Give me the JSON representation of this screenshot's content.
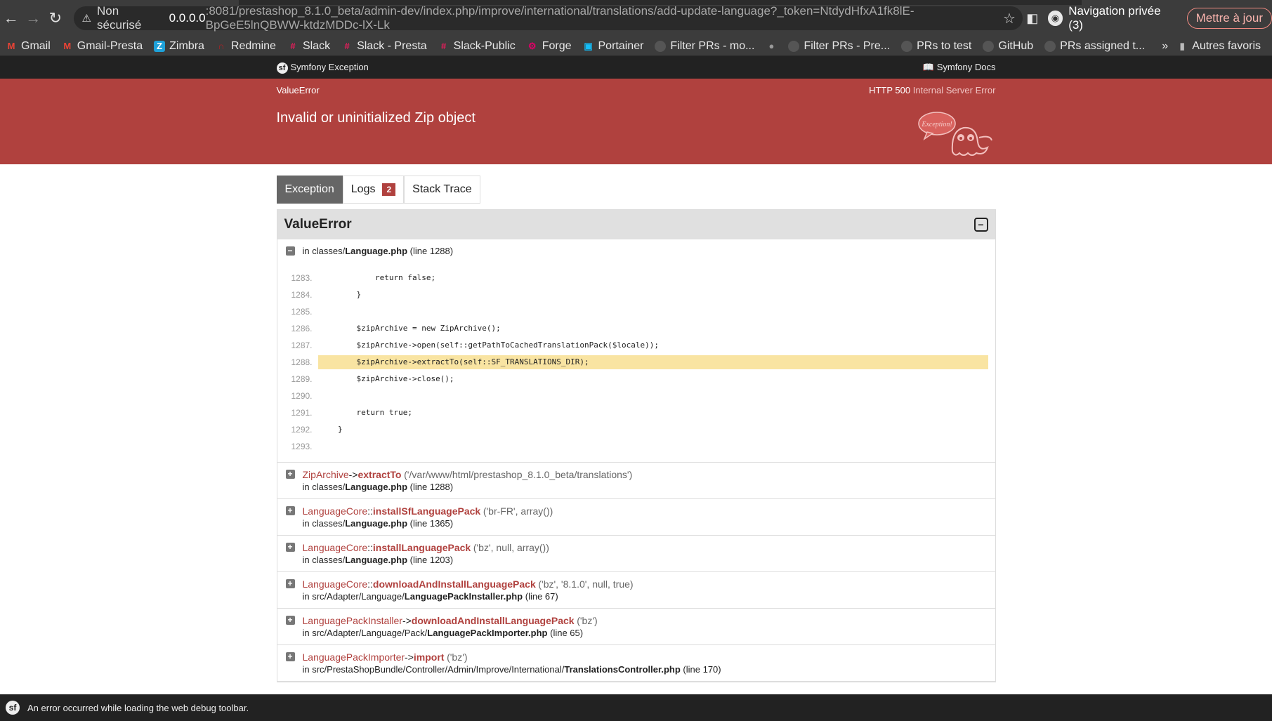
{
  "browser": {
    "url_warning": "Non sécurisé",
    "url_host": "0.0.0.0",
    "url_path": ":8081/prestashop_8.1.0_beta/admin-dev/index.php/improve/international/translations/add-update-language?_token=NtdydHfxA1fk8lE-BpGeE5lnQBWW-ktdzMDDc-lX-Lk",
    "private_label": "Navigation privée (3)",
    "update_label": "Mettre à jour",
    "bookmarks": [
      "Gmail",
      "Gmail-Presta",
      "Zimbra",
      "Redmine",
      "Slack",
      "Slack - Presta",
      "Slack-Public",
      "Forge",
      "Portainer",
      "Filter PRs - mo...",
      "",
      "Filter PRs - Pre...",
      "PRs to test",
      "GitHub",
      "PRs assigned t..."
    ],
    "more_bookmarks": "»",
    "other_bookmarks": "Autres favoris"
  },
  "sf": {
    "top_left": "Symfony Exception",
    "top_right": "Symfony Docs",
    "exception_class": "ValueError",
    "http_code": "HTTP 500",
    "http_text": "Internal Server Error",
    "message": "Invalid or uninitialized Zip object",
    "ghost_text": "Exception!"
  },
  "tabs": {
    "exception": "Exception",
    "logs": "Logs",
    "logs_count": "2",
    "stack": "Stack Trace"
  },
  "trace": {
    "title": "ValueError",
    "first_location": {
      "prefix": "in classes/",
      "file": "Language.php",
      "line": "(line 1288)"
    },
    "code": [
      {
        "num": "1283.",
        "text": "            return false;"
      },
      {
        "num": "1284.",
        "text": "        }"
      },
      {
        "num": "1285.",
        "text": ""
      },
      {
        "num": "1286.",
        "text": "        $zipArchive = new ZipArchive();"
      },
      {
        "num": "1287.",
        "text": "        $zipArchive->open(self::getPathToCachedTranslationPack($locale));"
      },
      {
        "num": "1288.",
        "text": "        $zipArchive->extractTo(self::SF_TRANSLATIONS_DIR);"
      },
      {
        "num": "1289.",
        "text": "        $zipArchive->close();"
      },
      {
        "num": "1290.",
        "text": ""
      },
      {
        "num": "1291.",
        "text": "        return true;"
      },
      {
        "num": "1292.",
        "text": "    }"
      },
      {
        "num": "1293.",
        "text": ""
      }
    ],
    "frames": [
      {
        "cls": "ZipArchive",
        "sep": "->",
        "fn": "extractTo",
        "args": "('/var/www/html/prestashop_8.1.0_beta/translations')",
        "prefix": "in classes/",
        "file": "Language.php",
        "line": "(line 1288)"
      },
      {
        "cls": "LanguageCore",
        "sep": "::",
        "fn": "installSfLanguagePack",
        "args": "('br-FR', array())",
        "prefix": "in classes/",
        "file": "Language.php",
        "line": "(line 1365)"
      },
      {
        "cls": "LanguageCore",
        "sep": "::",
        "fn": "installLanguagePack",
        "args": "('bz', null, array())",
        "prefix": "in classes/",
        "file": "Language.php",
        "line": "(line 1203)"
      },
      {
        "cls": "LanguageCore",
        "sep": "::",
        "fn": "downloadAndInstallLanguagePack",
        "args": "('bz', '8.1.0', null, true)",
        "prefix": "in src/Adapter/Language/",
        "file": "LanguagePackInstaller.php",
        "line": "(line 67)"
      },
      {
        "cls": "LanguagePackInstaller",
        "sep": "->",
        "fn": "downloadAndInstallLanguagePack",
        "args": "('bz')",
        "prefix": "in src/Adapter/Language/Pack/",
        "file": "LanguagePackImporter.php",
        "line": "(line 65)"
      },
      {
        "cls": "LanguagePackImporter",
        "sep": "->",
        "fn": "import",
        "args": "('bz')",
        "prefix": "in src/PrestaShopBundle/Controller/Admin/Improve/International/",
        "file": "TranslationsController.php",
        "line": "(line 170)"
      }
    ]
  },
  "debug_bar": {
    "message": "An error occurred while loading the web debug toolbar."
  }
}
